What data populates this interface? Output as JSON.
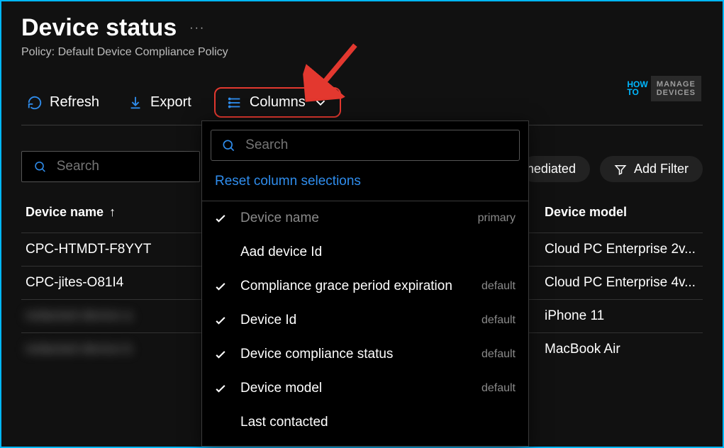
{
  "header": {
    "title": "Device status",
    "subtitle": "Policy: Default Device Compliance Policy",
    "more": "···"
  },
  "toolbar": {
    "refresh": "Refresh",
    "export": "Export",
    "columns": "Columns"
  },
  "logo": {
    "how": "HOW",
    "to": "TO",
    "line1": "MANAGE",
    "line2": "DEVICES"
  },
  "search": {
    "placeholder": "Search"
  },
  "filters": {
    "remediated_partial": "nediated",
    "add_filter": "Add Filter"
  },
  "table": {
    "columns": {
      "device_name": "Device name",
      "device_model": "Device model"
    },
    "sort_arrow": "↑",
    "rows": [
      {
        "name": "CPC-HTMDT-F8YYT",
        "model": "Cloud PC Enterprise 2v...",
        "blurred": false
      },
      {
        "name": "CPC-jites-O81I4",
        "model": "Cloud PC Enterprise 4v...",
        "blurred": false
      },
      {
        "name": "redacted device a",
        "model": "iPhone 11",
        "blurred": true
      },
      {
        "name": "redacted device b",
        "model": "MacBook Air",
        "blurred": true
      }
    ]
  },
  "dropdown": {
    "search_placeholder": "Search",
    "reset": "Reset column selections",
    "items": [
      {
        "label": "Device name",
        "checked": true,
        "tag": "primary",
        "primary": true
      },
      {
        "label": "Aad device Id",
        "checked": false,
        "tag": ""
      },
      {
        "label": "Compliance grace period expiration",
        "checked": true,
        "tag": "default"
      },
      {
        "label": "Device Id",
        "checked": true,
        "tag": "default"
      },
      {
        "label": "Device compliance status",
        "checked": true,
        "tag": "default"
      },
      {
        "label": "Device model",
        "checked": true,
        "tag": "default"
      },
      {
        "label": "Last contacted",
        "checked": false,
        "tag": ""
      }
    ]
  }
}
